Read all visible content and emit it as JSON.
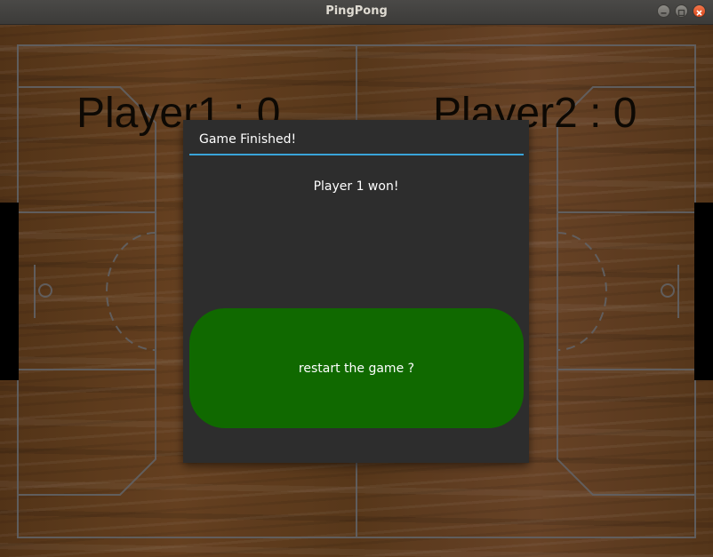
{
  "window": {
    "title": "PingPong",
    "controls": [
      "minimize-icon",
      "maximize-icon",
      "close-icon"
    ]
  },
  "game": {
    "player1_score_label": "Player1 : 0",
    "player2_score_label": "Player2 : 0"
  },
  "dialog": {
    "title": "Game Finished!",
    "message": "Player 1 won!",
    "restart_label": "restart the game ?"
  },
  "colors": {
    "dialog_background": "#2d2d2d",
    "title_separator": "#39a4d9",
    "restart_button": "#106900",
    "court_lines": "#6b6d72",
    "paddles": "#000000",
    "close_button": "#e95420"
  }
}
